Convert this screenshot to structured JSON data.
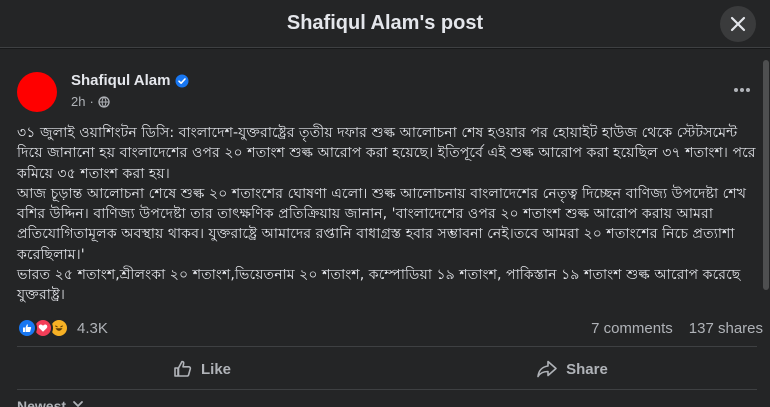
{
  "modal": {
    "title": "Shafiqul Alam's post",
    "close_icon": "close-icon"
  },
  "post": {
    "author": "Shafiqul Alam",
    "verified_icon": "verified-badge-icon",
    "time": "2h",
    "privacy_icon": "public-globe-icon",
    "more_icon": "more-dots-icon",
    "avatar_color": "#ff0000",
    "paragraphs": [
      "৩১ জুলাই ওয়াশিংটন ডিসি: বাংলাদেশ-যুক্তরাষ্ট্রের তৃতীয় দফার শুল্ক আলোচনা শেষ হওয়ার পর হোয়াইট হাউজ থেকে স্টেটসমেন্ট দিয়ে জানানো হয় বাংলাদেশের ওপর ২০ শতাংশ শুল্ক আরোপ করা হয়েছে। ইতিপূর্বে এই শুল্ক আরোপ করা হয়েছিল ৩৭ শতাংশ। পরে কমিয়ে ৩৫ শতাংশ করা হয়।",
      "আজ চূড়ান্ত আলোচনা শেষে শুল্ক ২০ শতাংশের ঘোষণা এলো। শুল্ক আলোচনায় বাংলাদেশের নেতৃত্ব দিচ্ছেন বাণিজ্য উপদেষ্টা শেখ বশির উদ্দিন। বাণিজ্য উপদেষ্টা তার তাৎক্ষণিক প্রতিক্রিয়ায় জানান, 'বাংলাদেশের ওপর ২০ শতাংশ শুল্ক আরোপ করায় আমরা প্রতিযোগিতামূলক অবস্থায় থাকব। যুক্তরাষ্ট্রে আমাদের রপ্তানি বাধাগ্রস্ত হবার সম্ভাবনা নেই।তবে আমরা ২০ শতাংশের নিচে প্রত্যাশা করেছিলাম।'",
      "ভারত ২৫ শতাংশ,শ্রীলংকা ২০ শতাংশ,ভিয়েতনাম ২০ শতাংশ, কম্পোডিয়া ১৯ শতাংশ, পাকিস্তান ১৯ শতাংশ শুল্ক আরোপ করেছে যুক্তরাষ্ট্র।"
    ]
  },
  "engagement": {
    "reaction_count": "4.3K",
    "comments": "7 comments",
    "shares": "137 shares",
    "reaction_icons": [
      "like-reaction-icon",
      "love-reaction-icon",
      "haha-reaction-icon"
    ]
  },
  "actions": {
    "like_label": "Like",
    "share_label": "Share",
    "like_icon": "thumbs-up-icon",
    "share_icon": "share-arrow-icon"
  },
  "comments_sort": {
    "label": "Newest"
  }
}
